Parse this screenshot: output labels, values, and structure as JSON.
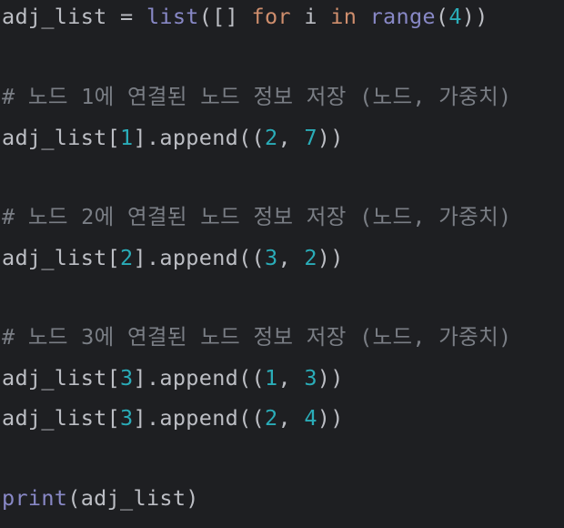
{
  "editor": {
    "lines": [
      {
        "tokens": [
          {
            "text": "adj_list = ",
            "kind": "plain"
          },
          {
            "text": "list",
            "kind": "builtin"
          },
          {
            "text": "([] ",
            "kind": "plain"
          },
          {
            "text": "for",
            "kind": "keyword"
          },
          {
            "text": " i ",
            "kind": "plain"
          },
          {
            "text": "in",
            "kind": "keyword"
          },
          {
            "text": " ",
            "kind": "plain"
          },
          {
            "text": "range",
            "kind": "builtin"
          },
          {
            "text": "(",
            "kind": "plain"
          },
          {
            "text": "4",
            "kind": "number"
          },
          {
            "text": "))",
            "kind": "plain"
          }
        ]
      },
      {
        "tokens": [
          {
            "text": "# 노드 1에 연결된 노드 정보 저장 (노드, 가중치)",
            "kind": "comment"
          }
        ]
      },
      {
        "tokens": [
          {
            "text": "adj_list[",
            "kind": "plain"
          },
          {
            "text": "1",
            "kind": "number"
          },
          {
            "text": "].append((",
            "kind": "plain"
          },
          {
            "text": "2",
            "kind": "number"
          },
          {
            "text": ", ",
            "kind": "plain"
          },
          {
            "text": "7",
            "kind": "number"
          },
          {
            "text": "))",
            "kind": "plain"
          }
        ]
      },
      {
        "tokens": [
          {
            "text": "# 노드 2에 연결된 노드 정보 저장 (노드, 가중치)",
            "kind": "comment"
          }
        ]
      },
      {
        "tokens": [
          {
            "text": "adj_list[",
            "kind": "plain"
          },
          {
            "text": "2",
            "kind": "number"
          },
          {
            "text": "].append((",
            "kind": "plain"
          },
          {
            "text": "3",
            "kind": "number"
          },
          {
            "text": ", ",
            "kind": "plain"
          },
          {
            "text": "2",
            "kind": "number"
          },
          {
            "text": "))",
            "kind": "plain"
          }
        ]
      },
      {
        "tokens": [
          {
            "text": "# 노드 3에 연결된 노드 정보 저장 (노드, 가중치)",
            "kind": "comment"
          }
        ]
      },
      {
        "tokens": [
          {
            "text": "adj_list[",
            "kind": "plain"
          },
          {
            "text": "3",
            "kind": "number"
          },
          {
            "text": "].append((",
            "kind": "plain"
          },
          {
            "text": "1",
            "kind": "number"
          },
          {
            "text": ", ",
            "kind": "plain"
          },
          {
            "text": "3",
            "kind": "number"
          },
          {
            "text": "))",
            "kind": "plain"
          }
        ]
      },
      {
        "tokens": [
          {
            "text": "adj_list[",
            "kind": "plain"
          },
          {
            "text": "3",
            "kind": "number"
          },
          {
            "text": "].append((",
            "kind": "plain"
          },
          {
            "text": "2",
            "kind": "number"
          },
          {
            "text": ", ",
            "kind": "plain"
          },
          {
            "text": "4",
            "kind": "number"
          },
          {
            "text": "))",
            "kind": "plain"
          }
        ]
      },
      {
        "tokens": [
          {
            "text": "print",
            "kind": "builtin"
          },
          {
            "text": "(adj_list)",
            "kind": "plain"
          }
        ]
      }
    ]
  },
  "colors": {
    "background": "#1e1f22",
    "plain": "#bcbec4",
    "builtin": "#8888c6",
    "keyword": "#cf8e6d",
    "number": "#2aacb8",
    "comment": "#7a7e85"
  }
}
